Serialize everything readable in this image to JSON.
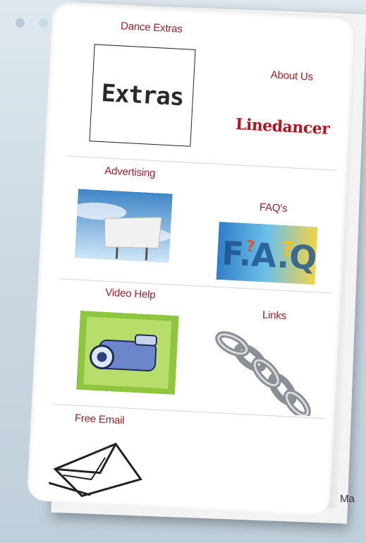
{
  "menu": {
    "items": [
      {
        "label": "Dance Extras",
        "icon": "extras-text-icon"
      },
      {
        "label": "About Us",
        "icon": "linedancer-logo"
      },
      {
        "label": "Advertising",
        "icon": "billboard-icon"
      },
      {
        "label": "FAQ's",
        "icon": "faq-icon"
      },
      {
        "label": "Video Help",
        "icon": "video-camera-icon"
      },
      {
        "label": "Links",
        "icon": "chain-links-icon"
      },
      {
        "label": "Free Email",
        "icon": "envelope-icon"
      }
    ],
    "extras_text": "Extras",
    "linedancer_text": "Linedancer"
  },
  "partial_text": "Ma",
  "colors": {
    "label_red": "#9e1f2b",
    "logo_red": "#b3141e",
    "background": "#c9d7e1"
  }
}
